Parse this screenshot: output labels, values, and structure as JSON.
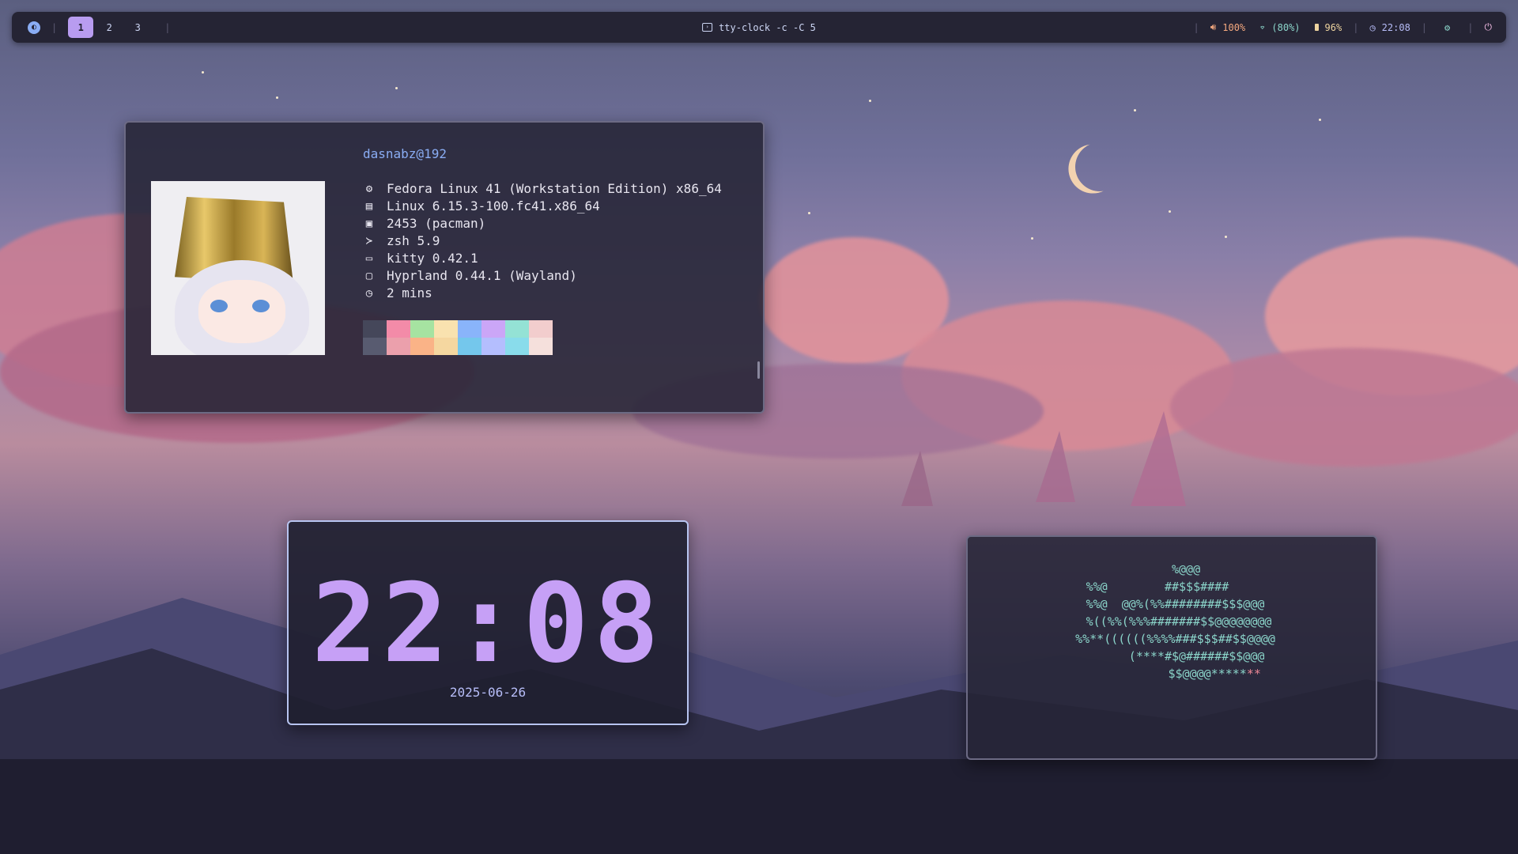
{
  "topbar": {
    "launcher_icon": "arch-swirl-icon",
    "workspaces": [
      "1",
      "2",
      "3"
    ],
    "active_workspace": "1",
    "window_icon": "terminal-icon",
    "window_title": "tty-clock -c -C 5",
    "volume_icon": "speaker-icon",
    "volume": "100%",
    "wifi_icon": "wifi-icon",
    "wifi": "(80%)",
    "battery_icon": "battery-icon",
    "battery": "96%",
    "clock_icon": "clock-icon",
    "time": "22:08",
    "settings_icon": "gear-icon",
    "power_icon": "power-icon"
  },
  "fastfetch": {
    "user": "dasnabz@192",
    "lines": [
      {
        "icon": "gear-icon",
        "glyph": "⚙",
        "text": "Fedora Linux 41 (Workstation Edition) x86_64"
      },
      {
        "icon": "kernel-icon",
        "glyph": "▤",
        "text": "Linux 6.15.3-100.fc41.x86_64"
      },
      {
        "icon": "package-icon",
        "glyph": "▣",
        "text": "2453 (pacman)"
      },
      {
        "icon": "shell-icon",
        "glyph": "≻",
        "text": "zsh 5.9"
      },
      {
        "icon": "terminal-icon",
        "glyph": "▭",
        "text": "kitty 0.42.1"
      },
      {
        "icon": "window-icon",
        "glyph": "▢",
        "text": "Hyprland 0.44.1 (Wayland)"
      },
      {
        "icon": "clock-icon",
        "glyph": "◷",
        "text": "2 mins"
      }
    ],
    "palette_top": [
      "#45475a",
      "#f38ba8",
      "#a6e3a1",
      "#f9e2af",
      "#89b4fa",
      "#cba6f7",
      "#94e2d5",
      "#f2cdcd"
    ],
    "palette_bottom": [
      "#585b70",
      "#eba0ac",
      "#fab387",
      "#f5d7a0",
      "#74c7ec",
      "#b4befe",
      "#89dceb",
      "#f5e0dc"
    ]
  },
  "clock": {
    "time": "22:08",
    "date": "2025-06-26",
    "color": "#c6a0f6"
  },
  "ascii_art": {
    "lines": [
      "            %@@@        ",
      "%%@        ##$$$####    ",
      " %%@  @@%(%%########$$$@@@",
      "  %((%%(%%%#######$$@@@@@@@@",
      " %%**((((((%%%%###$$$##$$@@@@",
      "       (****#$@######$$@@@",
      "            $$@@@@*****"
    ],
    "tail_red": "**"
  }
}
